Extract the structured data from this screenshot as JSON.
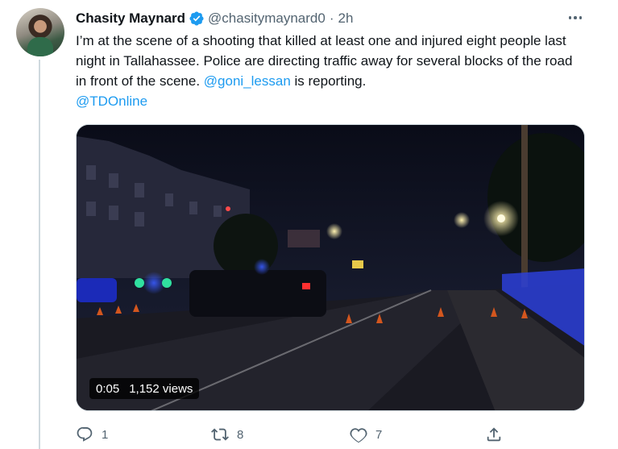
{
  "tweet": {
    "author_name": "Chasity Maynard",
    "handle": "@chasitymaynard0",
    "separator": "·",
    "time": "2h",
    "text_main": "I’m at the scene of a shooting that killed at least one and injured eight people last night in Tallahassee. Police are directing traffic away for several blocks of the road in front of the scene.",
    "mention_1": "@goni_lessan",
    "text_after_mention": "is reporting.",
    "mention_2": "@TDOnline"
  },
  "video": {
    "duration": "0:05",
    "views": "1,152 views"
  },
  "actions": {
    "reply_count": "1",
    "retweet_count": "8",
    "like_count": "7"
  },
  "colors": {
    "link": "#1d9bf0",
    "muted": "#536471",
    "verified": "#1d9bf0"
  },
  "icons": [
    "verified-badge-icon",
    "more-icon",
    "reply-icon",
    "retweet-icon",
    "like-icon",
    "share-icon"
  ]
}
